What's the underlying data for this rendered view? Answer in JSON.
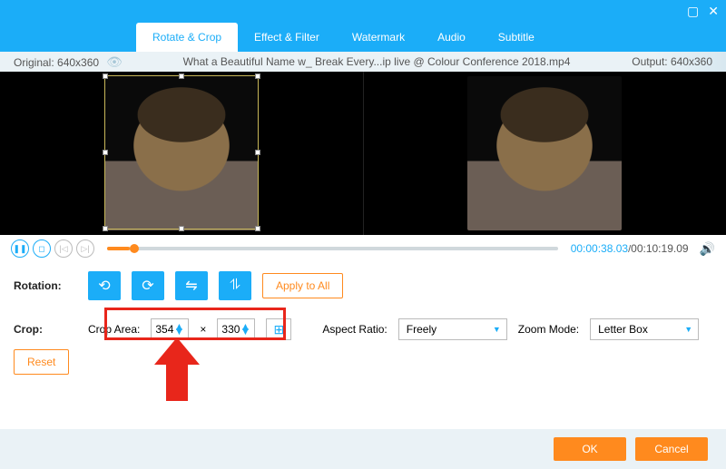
{
  "window": {
    "maximize": "▢",
    "close": "✕"
  },
  "tabs": {
    "rotate_crop": "Rotate & Crop",
    "effect_filter": "Effect & Filter",
    "watermark": "Watermark",
    "audio": "Audio",
    "subtitle": "Subtitle"
  },
  "infobar": {
    "original_label": "Original: 640x360",
    "filename": "What a Beautiful Name w_ Break Every...ip live @ Colour Conference 2018.mp4",
    "output_label": "Output: 640x360"
  },
  "playback": {
    "current": "00:00:38.03",
    "total": "00:10:19.09"
  },
  "rotation": {
    "label": "Rotation:",
    "apply": "Apply to All"
  },
  "crop": {
    "label": "Crop:",
    "area_label": "Crop Area:",
    "w": "354",
    "h": "330",
    "x": "×",
    "aspect_label": "Aspect Ratio:",
    "aspect": "Freely",
    "zoom_label": "Zoom Mode:",
    "zoom": "Letter Box",
    "reset": "Reset"
  },
  "footer": {
    "ok": "OK",
    "cancel": "Cancel"
  },
  "icons": {
    "rot_ccw": "⟲",
    "rot_cw": "⟳",
    "flip_h": "⇋",
    "flip_v": "⥮",
    "play": "❚❚",
    "stop": "◻",
    "prev": "|◁",
    "next": "▷|",
    "vol": "🔊",
    "eye": "👁",
    "crop": "⊞"
  }
}
